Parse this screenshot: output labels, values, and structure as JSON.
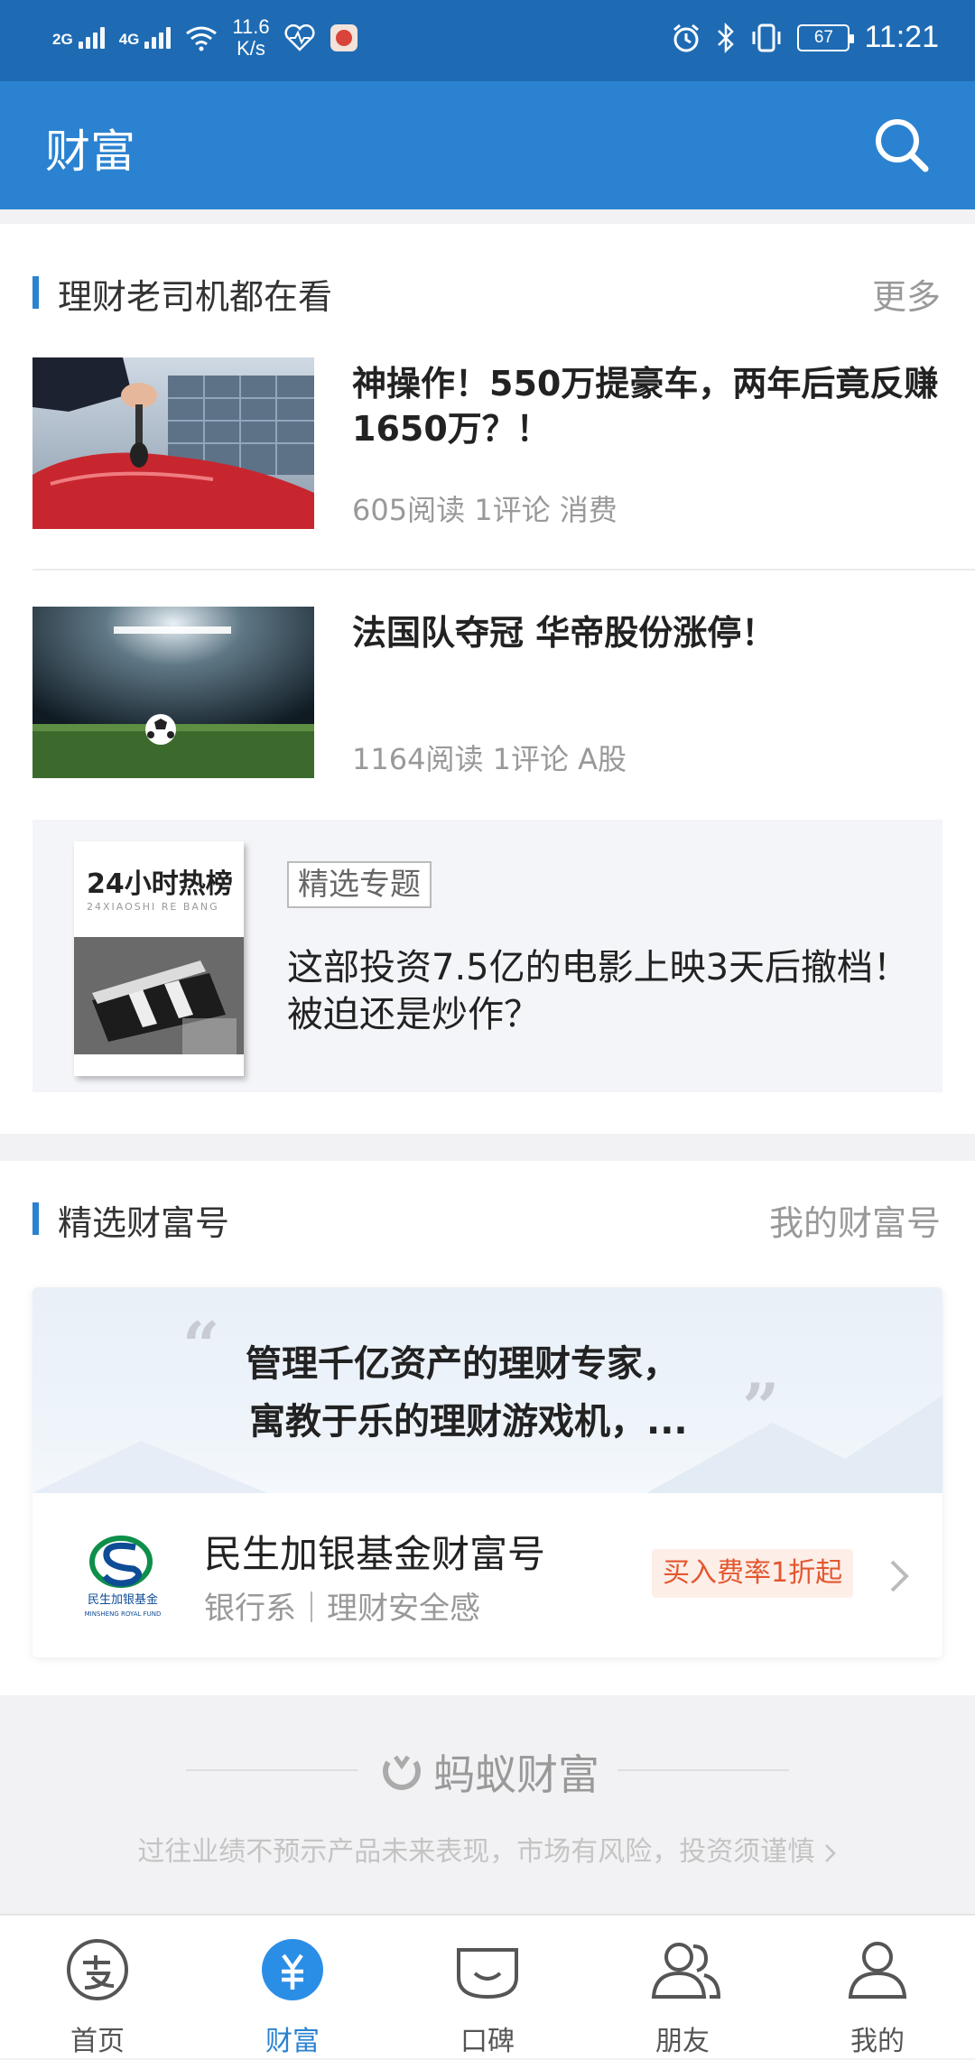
{
  "status_bar": {
    "net1": "2G",
    "net2": "4G",
    "speed_value": "11.6",
    "speed_unit": "K/s",
    "battery": "67",
    "time": "11:21"
  },
  "app_bar": {
    "title": "财富",
    "search_icon": "search-icon"
  },
  "section1": {
    "title": "理财老司机都在看",
    "more": "更多",
    "articles": [
      {
        "title": "神操作！550万提豪车，两年后竟反赚1650万？！",
        "meta": "605阅读 1评论 消费"
      },
      {
        "title": "法国队夺冠 华帝股份涨停！",
        "meta": "1164阅读 1评论 A股"
      }
    ],
    "topic": {
      "book_title": "24小时热榜",
      "book_sub": "24XIAOSHI RE BANG",
      "tag": "精选专题",
      "title": "这部投资7.5亿的电影上映3天后撤档！被迫还是炒作？"
    }
  },
  "section2": {
    "title": "精选财富号",
    "more": "我的财富号",
    "quote_line1": "管理千亿资产的理财专家，",
    "quote_line2": "寓教于乐的理财游戏机，...",
    "fund": {
      "logo_text": "民生加银基金",
      "logo_sub": "MINSHENG ROYAL FUND",
      "name": "民生加银基金财富号",
      "subtitle": "银行系｜理财安全感",
      "badge": "买入费率1折起"
    }
  },
  "footer": {
    "brand": "蚂蚁财富",
    "disclaimer": "过往业绩不预示产品未来表现，市场有风险，投资须谨慎"
  },
  "tab_bar": {
    "items": [
      {
        "label": "首页",
        "icon": "alipay-home-icon"
      },
      {
        "label": "财富",
        "icon": "yuan-icon"
      },
      {
        "label": "口碑",
        "icon": "koubei-icon"
      },
      {
        "label": "朋友",
        "icon": "friends-icon"
      },
      {
        "label": "我的",
        "icon": "profile-icon"
      }
    ]
  },
  "colors": {
    "primary": "#2b82d0",
    "status_bar": "#1e6bb4",
    "badge_text": "#e4572e"
  }
}
